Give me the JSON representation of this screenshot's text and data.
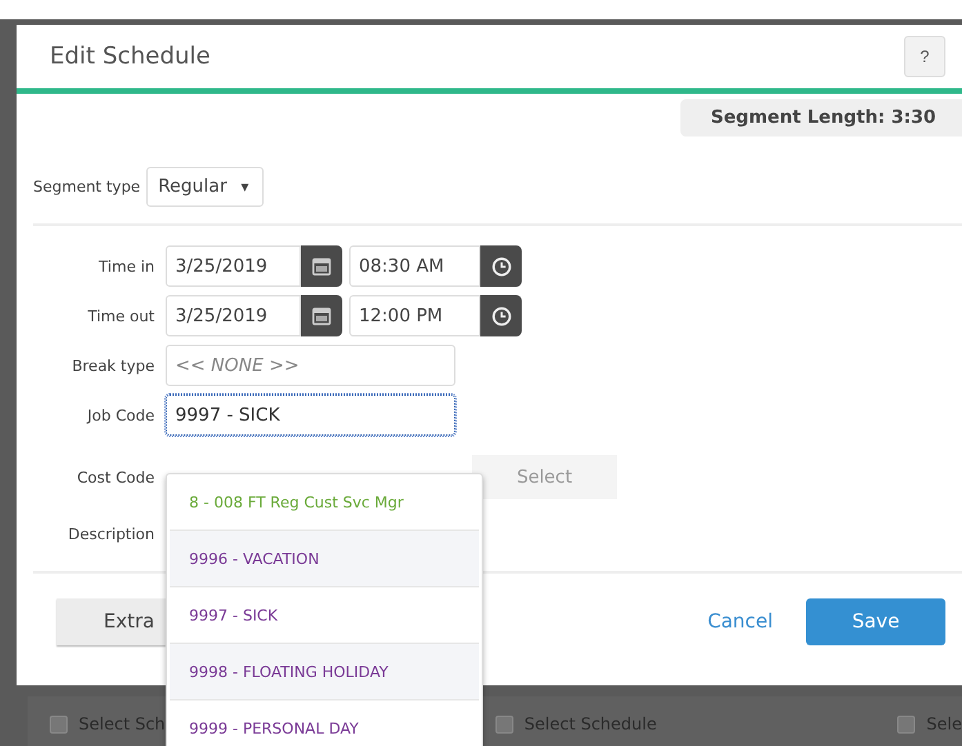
{
  "dialog": {
    "title": "Edit Schedule",
    "help_button": "?",
    "segment_length": "Segment Length: 3:30",
    "segment_type": {
      "label": "Segment type",
      "value": "Regular",
      "caret": "▾"
    },
    "time_in": {
      "label": "Time in",
      "date": "3/25/2019",
      "time": "08:30 AM"
    },
    "time_out": {
      "label": "Time out",
      "date": "3/25/2019",
      "time": "12:00 PM"
    },
    "break_type": {
      "label": "Break type",
      "placeholder": "<< NONE >>"
    },
    "job_code": {
      "label": "Job Code",
      "value": "9997 - SICK"
    },
    "cost_code": {
      "label": "Cost Code",
      "button": "Select"
    },
    "description": {
      "label": "Description"
    },
    "buttons": {
      "extra": "Extra",
      "cancel": "Cancel",
      "save": "Save"
    }
  },
  "job_code_dropdown": [
    {
      "label": "8 - 008 FT Reg Cust Svc Mgr",
      "color": "#6aaa3a"
    },
    {
      "label": "9996 - VACATION",
      "color": "#7a3a96"
    },
    {
      "label": "9997 - SICK",
      "color": "#7a3a96"
    },
    {
      "label": "9998 - FLOATING HOLIDAY",
      "color": "#7a3a96"
    },
    {
      "label": "9999 - PERSONAL DAY",
      "color": "#7a3a96"
    }
  ],
  "background_row": [
    {
      "label": "Select Sch",
      "checked": false
    },
    {
      "label": "Select Schedule",
      "checked": false
    },
    {
      "label": "Sele",
      "checked": false
    }
  ]
}
